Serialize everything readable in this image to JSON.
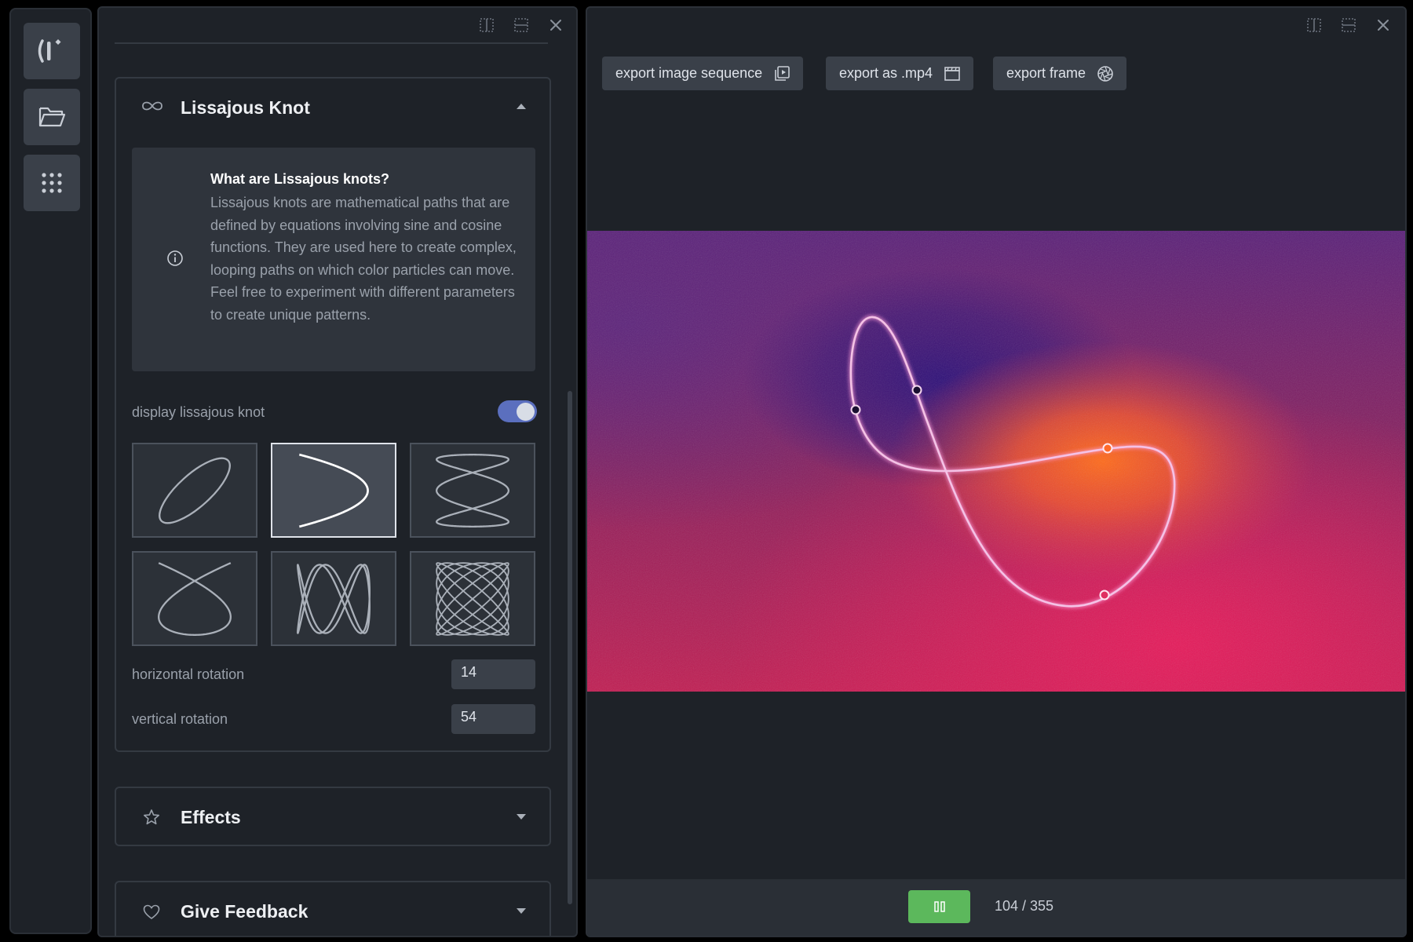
{
  "sidebar": {
    "items": [
      {
        "name": "logo-icon"
      },
      {
        "name": "folder-icon"
      },
      {
        "name": "grid-icon"
      }
    ]
  },
  "left_panel": {
    "header_icons": [
      "split-vertical-icon",
      "split-horizontal-icon",
      "close-icon"
    ],
    "lissajous": {
      "title": "Lissajous Knot",
      "icon": "infinity-icon",
      "info_title": "What are Lissajous knots?",
      "info_text": "Lissajous knots are mathematical paths that are defined by equations involving sine and cosine functions. They are used here to create complex, looping paths on which color particles can move. Feel free to experiment with different parameters to create unique patterns.",
      "display_label": "display lissajous knot",
      "display_on": true,
      "selected_preset": 2,
      "horizontal_label": "horizontal rotation",
      "horizontal_value": "14",
      "vertical_label": "vertical rotation",
      "vertical_value": "54"
    },
    "effects": {
      "title": "Effects",
      "icon": "star-icon"
    },
    "feedback": {
      "title": "Give Feedback",
      "icon": "heart-icon"
    }
  },
  "right_panel": {
    "header_icons": [
      "split-vertical-icon",
      "split-horizontal-icon",
      "close-icon"
    ],
    "exports": [
      {
        "label": "export image sequence",
        "icon": "image-sequence-icon"
      },
      {
        "label": "export as .mp4",
        "icon": "film-icon"
      },
      {
        "label": "export frame",
        "icon": "aperture-icon"
      }
    ],
    "frame_counter": "104 / 355",
    "colors": {
      "play_button": "#5cb85c",
      "toggle_on": "#5b6fbe"
    }
  }
}
